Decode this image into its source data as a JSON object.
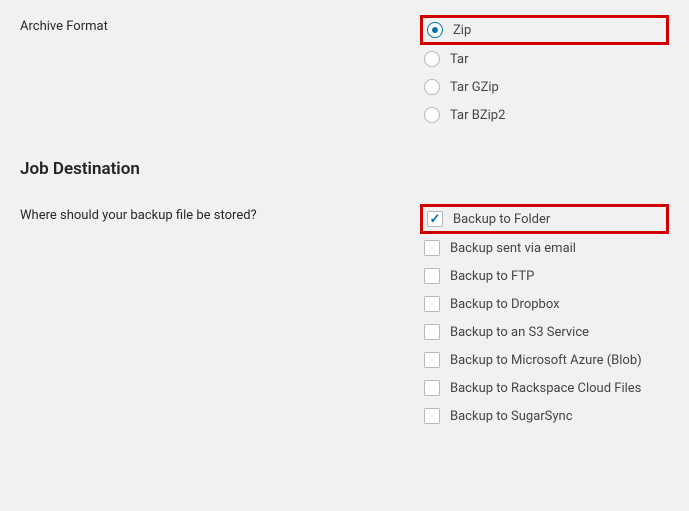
{
  "archive_format": {
    "label": "Archive Format",
    "options": [
      {
        "label": "Zip",
        "checked": true,
        "highlighted": true
      },
      {
        "label": "Tar",
        "checked": false,
        "highlighted": false
      },
      {
        "label": "Tar GZip",
        "checked": false,
        "highlighted": false
      },
      {
        "label": "Tar BZip2",
        "checked": false,
        "highlighted": false
      }
    ]
  },
  "job_destination": {
    "heading": "Job Destination",
    "label": "Where should your backup file be stored?",
    "options": [
      {
        "label": "Backup to Folder",
        "checked": true,
        "highlighted": true
      },
      {
        "label": "Backup sent via email",
        "checked": false,
        "highlighted": false
      },
      {
        "label": "Backup to FTP",
        "checked": false,
        "highlighted": false
      },
      {
        "label": "Backup to Dropbox",
        "checked": false,
        "highlighted": false
      },
      {
        "label": "Backup to an S3 Service",
        "checked": false,
        "highlighted": false
      },
      {
        "label": "Backup to Microsoft Azure (Blob)",
        "checked": false,
        "highlighted": false
      },
      {
        "label": "Backup to Rackspace Cloud Files",
        "checked": false,
        "highlighted": false
      },
      {
        "label": "Backup to SugarSync",
        "checked": false,
        "highlighted": false
      }
    ]
  }
}
